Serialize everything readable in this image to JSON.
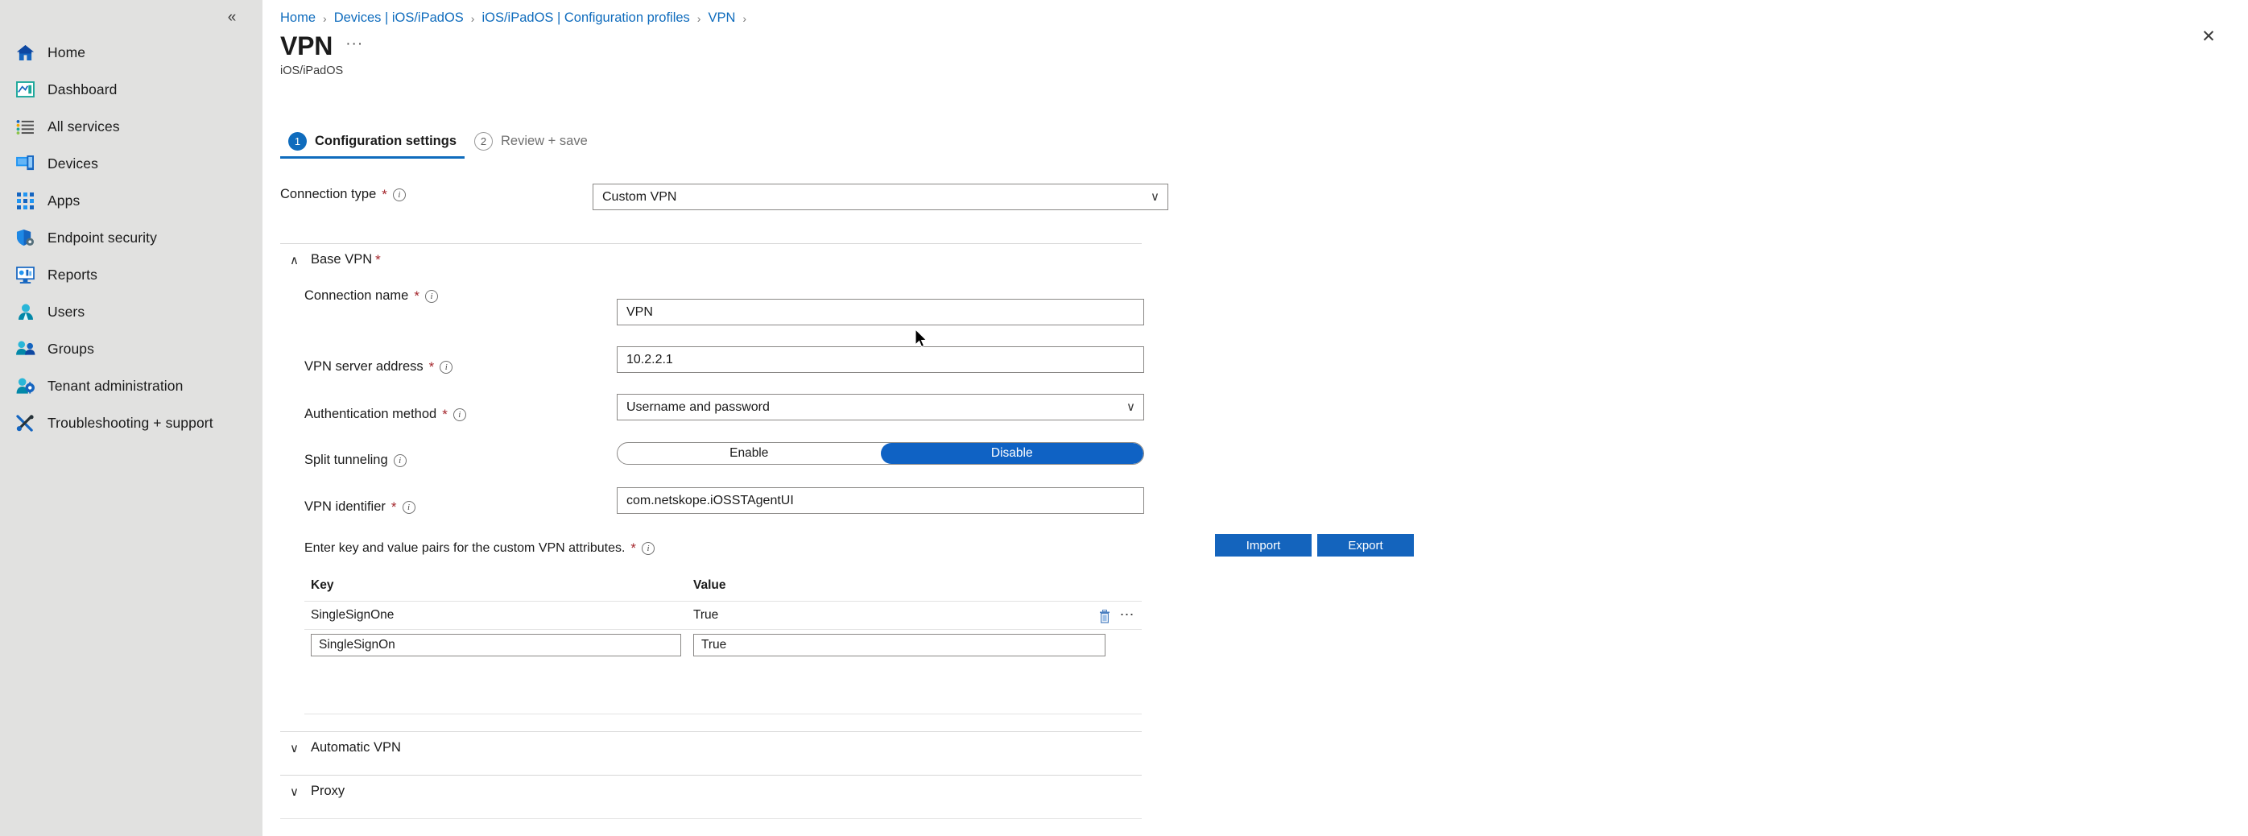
{
  "sidebar": {
    "collapse_glyph": "«",
    "items": [
      {
        "label": "Home",
        "icon": "home-icon"
      },
      {
        "label": "Dashboard",
        "icon": "dashboard-icon"
      },
      {
        "label": "All services",
        "icon": "all-services-icon"
      },
      {
        "label": "Devices",
        "icon": "devices-icon"
      },
      {
        "label": "Apps",
        "icon": "apps-icon"
      },
      {
        "label": "Endpoint security",
        "icon": "endpoint-security-icon"
      },
      {
        "label": "Reports",
        "icon": "reports-icon"
      },
      {
        "label": "Users",
        "icon": "users-icon"
      },
      {
        "label": "Groups",
        "icon": "groups-icon"
      },
      {
        "label": "Tenant administration",
        "icon": "tenant-administration-icon"
      },
      {
        "label": "Troubleshooting + support",
        "icon": "troubleshooting-icon"
      }
    ]
  },
  "breadcrumb": {
    "items": [
      "Home",
      "Devices | iOS/iPadOS",
      "iOS/iPadOS | Configuration profiles",
      "VPN"
    ],
    "separator": "›",
    "trailing_separator": "›"
  },
  "header": {
    "title": "VPN",
    "ellipsis": "···",
    "subtitle": "iOS/iPadOS",
    "close_glyph": "✕"
  },
  "tabs": [
    {
      "num": "1",
      "label": "Configuration settings",
      "active": true
    },
    {
      "num": "2",
      "label": "Review + save",
      "active": false
    }
  ],
  "form": {
    "connection_type": {
      "label": "Connection type",
      "required": "*",
      "value": "Custom VPN",
      "chevron": "∨"
    },
    "base_vpn": {
      "caret": "∧",
      "title": "Base VPN",
      "required": "*",
      "connection_name": {
        "label": "Connection name",
        "required": "*",
        "value": "VPN"
      },
      "vpn_server_address": {
        "label": "VPN server address",
        "required": "*",
        "value": "10.2.2.1"
      },
      "authentication_method": {
        "label": "Authentication method",
        "required": "*",
        "value": "Username and password",
        "chevron": "∨"
      },
      "split_tunneling": {
        "label": "Split tunneling",
        "enable_label": "Enable",
        "disable_label": "Disable",
        "selected": "Disable"
      },
      "vpn_identifier": {
        "label": "VPN identifier",
        "required": "*",
        "value": "com.netskope.iOSSTAgentUI"
      },
      "kv_note": "Enter key and value pairs for the custom VPN attributes.",
      "kv_note_required": "*",
      "import_label": "Import",
      "export_label": "Export",
      "table": {
        "columns": [
          "Key",
          "Value"
        ],
        "rows": [
          {
            "key": "SingleSignOne",
            "value": "True"
          }
        ],
        "edit_row": {
          "key": "SingleSignOn",
          "value": "True"
        }
      }
    },
    "automatic_vpn": {
      "caret": "∨",
      "title": "Automatic VPN"
    },
    "proxy": {
      "caret": "∨",
      "title": "Proxy"
    }
  },
  "colors": {
    "accent": "#0f6cbd",
    "button": "#1464bd",
    "toggle_on": "#0f62c4",
    "required": "#a4262c",
    "sidebar_bg": "#e1e1e0"
  }
}
